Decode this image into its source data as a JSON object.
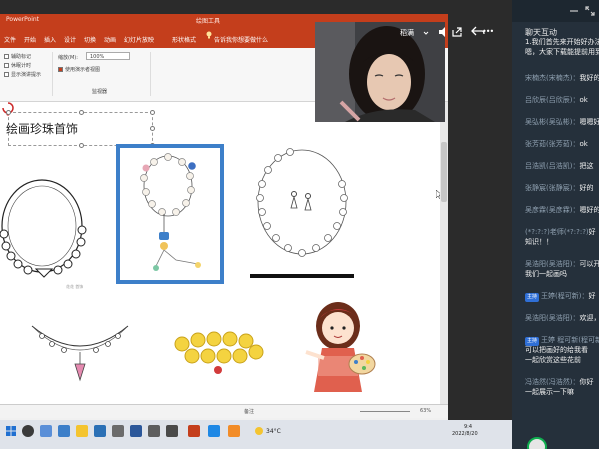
{
  "ppt": {
    "title_file": "PowerPoint",
    "title_tools": "绘图工具",
    "tabs": [
      "文件",
      "开始",
      "插入",
      "设计",
      "切换",
      "动画",
      "幻灯片放映",
      "形状格式",
      "告诉我你想要做什么"
    ],
    "ribbon": {
      "checkbox_1": "辅助标记",
      "checkbox_2": "休眠计时",
      "checkbox_3": "显示演讲提示",
      "zoom_label": "缩放(M):",
      "zoom_value": "100%",
      "checkbox_4": "使用演示者视图",
      "group_label": "监视器"
    },
    "status_notes": "备注",
    "status_zoom": "63%"
  },
  "slide": {
    "title": "绘画珍珠首饰",
    "watermark": "花花 首饰"
  },
  "webcam": {
    "name_label": "稻满",
    "menu_dots": "•••"
  },
  "taskbar": {
    "weather": "34°C",
    "time": "9:4",
    "date": "2022/8/20"
  },
  "chat": {
    "title": "聊天互动",
    "messages": [
      {
        "name": "",
        "text": "1.我们首先来开始好办法。"
      },
      {
        "name": "",
        "text": "嗯，大家下载能提前用到"
      },
      {
        "name": "宋楠杰(宋楠杰)：",
        "text": "我好的"
      },
      {
        "name": "吕欣辰(吕欣辰)：",
        "text": "ok"
      },
      {
        "name": "吴弘彬(吴弘彬)：",
        "text": "嗯嗯好"
      },
      {
        "name": "张芳茹(张芳茹)：",
        "text": "ok"
      },
      {
        "name": "吕浩凯(吕浩凯)：",
        "text": "把这"
      },
      {
        "name": "张静宸(张静宸)：",
        "text": "好的"
      },
      {
        "name": "吴彦霖(吴彦霖)：",
        "text": "嗯好的"
      },
      {
        "name": "(*?:?:?)老师(*?:?:?)",
        "text": "好"
      },
      {
        "name": "",
        "text": "知识！！"
      },
      {
        "name": "吴浩阳(吴浩阳)：",
        "text": "可以开"
      },
      {
        "name": "",
        "text": "我们一起画吗"
      },
      {
        "name": "王婷(程可新)：",
        "text": "好"
      },
      {
        "name": "吴浩阳(吴浩阳)：",
        "text": "欢迎，"
      },
      {
        "name": "王婷 程可新(程可新)：",
        "text": ""
      },
      {
        "name": "",
        "text": "可以把画好的给我看"
      },
      {
        "name": "",
        "text": "一起欣赏这些花前"
      },
      {
        "name": "冯浩然(冯浩然)：",
        "text": "你好"
      },
      {
        "name": "",
        "text": "一起展示一下嘛"
      }
    ],
    "tag_label": "主持"
  }
}
